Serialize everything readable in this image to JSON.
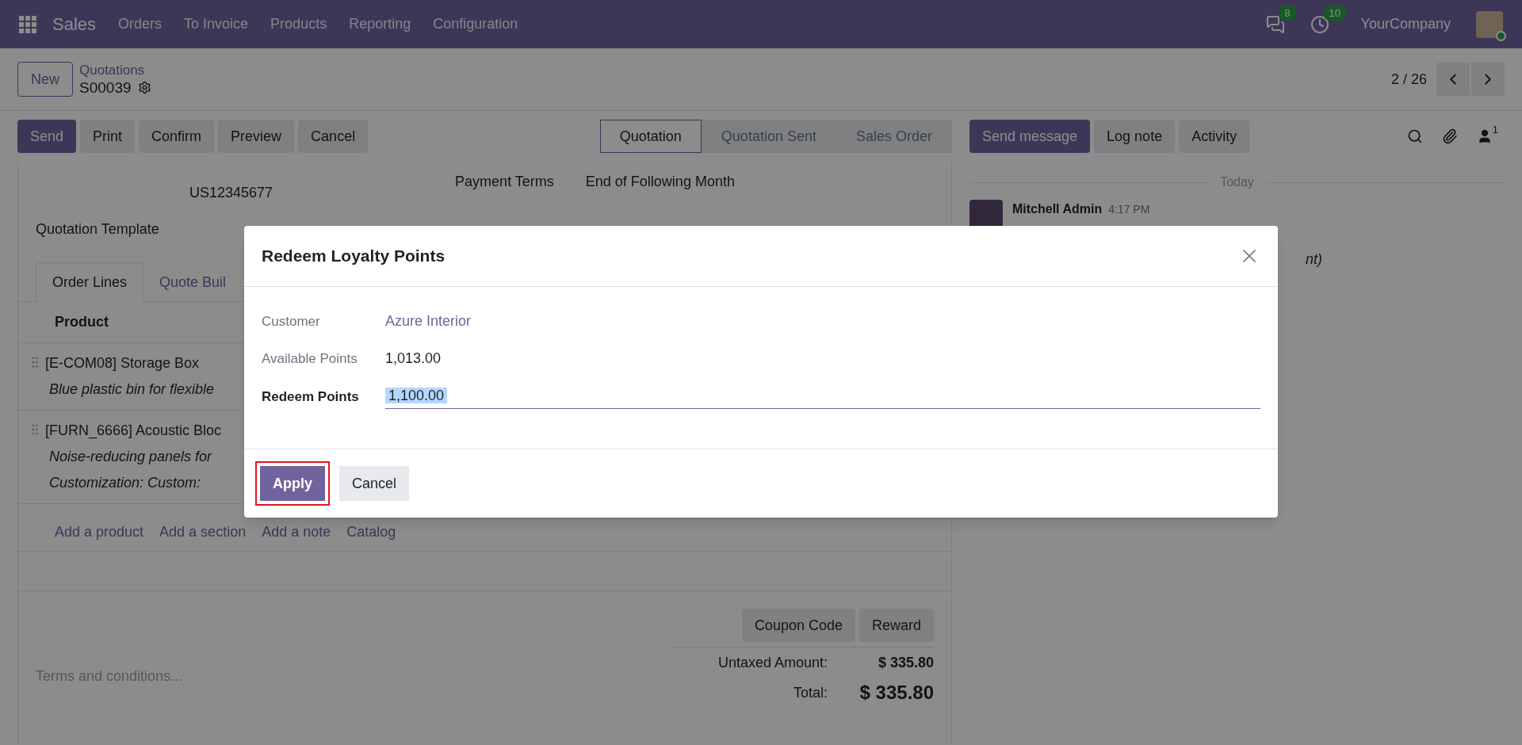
{
  "navbar": {
    "app_name": "Sales",
    "menu": [
      "Orders",
      "To Invoice",
      "Products",
      "Reporting",
      "Configuration"
    ],
    "messages_badge": "8",
    "activity_badge": "10",
    "company": "YourCompany"
  },
  "control_panel": {
    "new_button": "New",
    "breadcrumb": "Quotations",
    "record": "S00039",
    "pager": "2 / 26"
  },
  "actions": [
    {
      "label": "Send",
      "primary": true
    },
    {
      "label": "Print",
      "primary": false
    },
    {
      "label": "Confirm",
      "primary": false
    },
    {
      "label": "Preview",
      "primary": false
    },
    {
      "label": "Cancel",
      "primary": false
    }
  ],
  "statusbar": [
    {
      "label": "Quotation",
      "selected": true
    },
    {
      "label": "Quotation Sent",
      "selected": false
    },
    {
      "label": "Sales Order",
      "selected": false
    }
  ],
  "form": {
    "vat": "US12345677",
    "payment_terms_label": "Payment Terms",
    "payment_terms_value": "End of Following Month",
    "template_label": "Quotation Template",
    "tabs": [
      {
        "label": "Order Lines",
        "selected": true
      },
      {
        "label": "Quote Buil",
        "selected": false
      }
    ],
    "column": "Product",
    "lines": [
      {
        "name": "[E-COM08] Storage Box",
        "notes": [
          "Blue plastic bin for flexible"
        ]
      },
      {
        "name": "[FURN_6666] Acoustic Bloc",
        "notes": [
          "Noise-reducing panels for",
          "Customization: Custom:"
        ]
      }
    ],
    "add_links": [
      "Add a product",
      "Add a section",
      "Add a note",
      "Catalog"
    ],
    "reward_buttons": [
      "Coupon Code",
      "Reward"
    ],
    "terms_placeholder": "Terms and conditions...",
    "totals": [
      {
        "label": "Untaxed Amount:",
        "value": "$ 335.80",
        "kind": "subtotal"
      },
      {
        "label": "Total:",
        "value": "$ 335.80",
        "kind": "total"
      }
    ]
  },
  "chatter": {
    "buttons": [
      {
        "label": "Send message",
        "primary": true
      },
      {
        "label": "Log note",
        "primary": false
      },
      {
        "label": "Activity",
        "primary": false
      }
    ],
    "followers": "1",
    "date_separator": "Today",
    "author": "Mitchell Admin",
    "time": "4:17 PM",
    "fragment": "nt)"
  },
  "dialog": {
    "title": "Redeem Loyalty Points",
    "fields": [
      {
        "label": "Customer",
        "value": "Azure Interior",
        "kind": "link"
      },
      {
        "label": "Available Points",
        "value": "1,013.00",
        "kind": "text"
      },
      {
        "label": "Redeem Points",
        "value": "1,100.00",
        "kind": "input"
      }
    ],
    "buttons": [
      {
        "label": "Apply",
        "primary": true,
        "highlighted": true
      },
      {
        "label": "Cancel",
        "primary": false,
        "highlighted": false
      }
    ]
  }
}
